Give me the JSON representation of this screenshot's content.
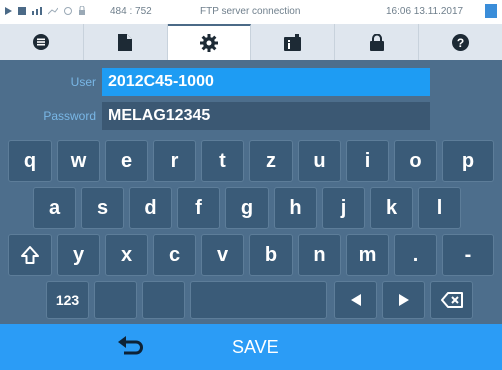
{
  "status_bar": {
    "coords": "484 : 752",
    "title": "FTP server connection",
    "datetime": "16:06  13.11.2017"
  },
  "tabs": [
    {
      "icon": "list-icon"
    },
    {
      "icon": "document-icon"
    },
    {
      "icon": "gear-icon"
    },
    {
      "icon": "info-device-icon"
    },
    {
      "icon": "lock-icon"
    },
    {
      "icon": "help-icon"
    }
  ],
  "form": {
    "user_label": "User",
    "user_value": "2012C45-1000",
    "password_label": "Password",
    "password_value": "MELAG12345"
  },
  "keyboard": {
    "row1": [
      "q",
      "w",
      "e",
      "r",
      "t",
      "z",
      "u",
      "i",
      "o",
      "p"
    ],
    "row2": [
      "a",
      "s",
      "d",
      "f",
      "g",
      "h",
      "j",
      "k",
      "l"
    ],
    "row3": [
      "y",
      "x",
      "c",
      "v",
      "b",
      "n",
      "m",
      ".",
      "-"
    ],
    "mode_key": "123"
  },
  "footer": {
    "save_label": "SAVE"
  },
  "colors": {
    "accent": "#2b9cf6",
    "panel": "#4d6e8c",
    "key": "#3a5b78",
    "label": "#79b7e6"
  }
}
